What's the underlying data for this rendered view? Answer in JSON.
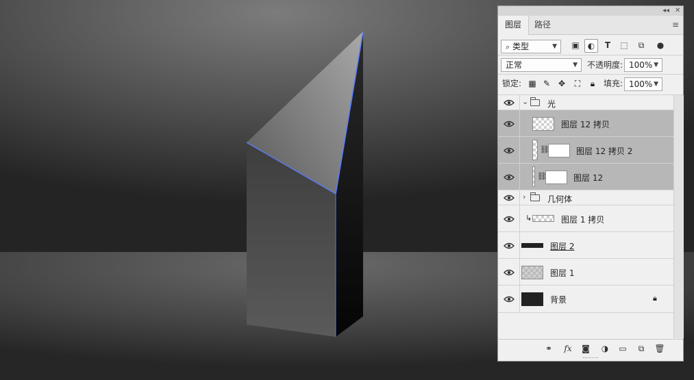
{
  "canvas": {
    "background_top": "#7a7a7a",
    "background_bottom": "#2a2a2a",
    "edge_glow": "#4a6fff"
  },
  "panel": {
    "tabs": [
      {
        "label": "图层",
        "active": true
      },
      {
        "label": "路径",
        "active": false
      }
    ],
    "filter": {
      "kind_label": "类型",
      "icons": [
        "image-filter-icon",
        "adjustment-filter-icon",
        "type-filter-icon",
        "shape-filter-icon",
        "smart-object-filter-icon",
        "toggle-filter-icon"
      ]
    },
    "blend_mode": "正常",
    "opacity_label": "不透明度:",
    "opacity_value": "100%",
    "lock_label": "锁定:",
    "fill_label": "填充:",
    "fill_value": "100%",
    "layers": [
      {
        "name": "光",
        "type": "group",
        "expanded": true
      },
      {
        "name": "图层 12 拷贝",
        "type": "layer",
        "selected": true
      },
      {
        "name": "图层 12 拷贝 2",
        "type": "masked",
        "selected": true
      },
      {
        "name": "图层 12",
        "type": "masked",
        "selected": true
      },
      {
        "name": "几何体",
        "type": "group",
        "expanded": false
      },
      {
        "name": "图层 1 拷贝",
        "type": "clipped"
      },
      {
        "name": "图层 2",
        "type": "dark"
      },
      {
        "name": "图层 1",
        "type": "gradient"
      },
      {
        "name": "背景",
        "type": "background",
        "locked": true
      }
    ],
    "bottom_icons": [
      "link-icon",
      "fx-icon",
      "add-mask-icon",
      "adjustment-layer-icon",
      "new-group-icon",
      "new-layer-icon",
      "delete-icon"
    ],
    "bottom_fx_label": "fx"
  }
}
